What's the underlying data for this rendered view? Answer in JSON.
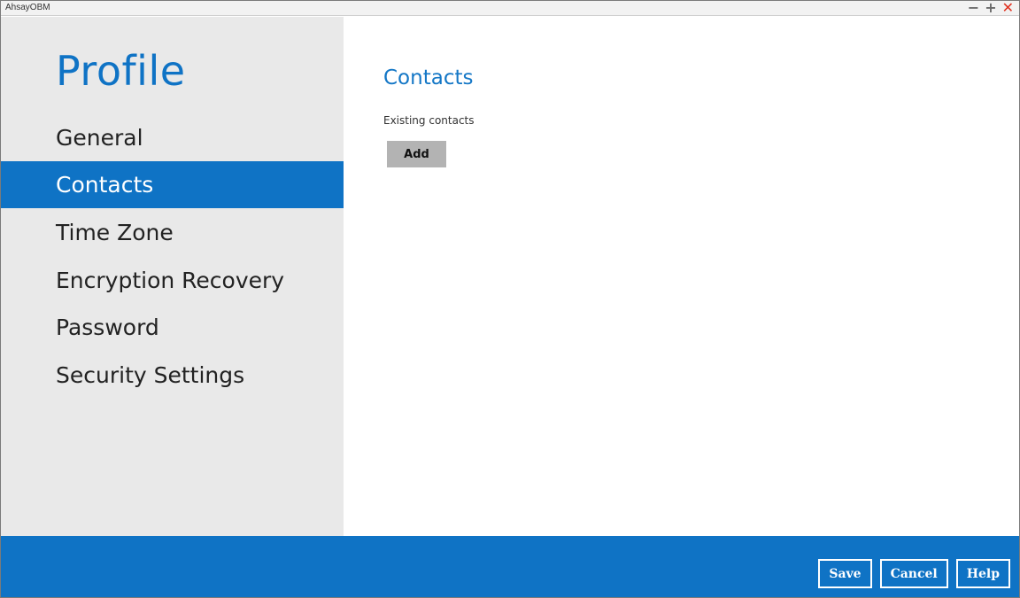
{
  "window": {
    "title": "AhsayOBM",
    "controls": {
      "minimize": "−",
      "maximize": "+",
      "close": "✕"
    }
  },
  "sidebar": {
    "heading": "Profile",
    "items": [
      {
        "label": "General",
        "active": false
      },
      {
        "label": "Contacts",
        "active": true
      },
      {
        "label": "Time Zone",
        "active": false
      },
      {
        "label": "Encryption Recovery",
        "active": false
      },
      {
        "label": "Password",
        "active": false
      },
      {
        "label": "Security Settings",
        "active": false
      }
    ]
  },
  "main": {
    "title": "Contacts",
    "subtitle": "Existing contacts",
    "add_label": "Add"
  },
  "footer": {
    "save_label": "Save",
    "cancel_label": "Cancel",
    "help_label": "Help"
  },
  "colors": {
    "accent": "#0f73c5",
    "sidebar_bg": "#e9e9e9",
    "close_red": "#e0301e"
  }
}
